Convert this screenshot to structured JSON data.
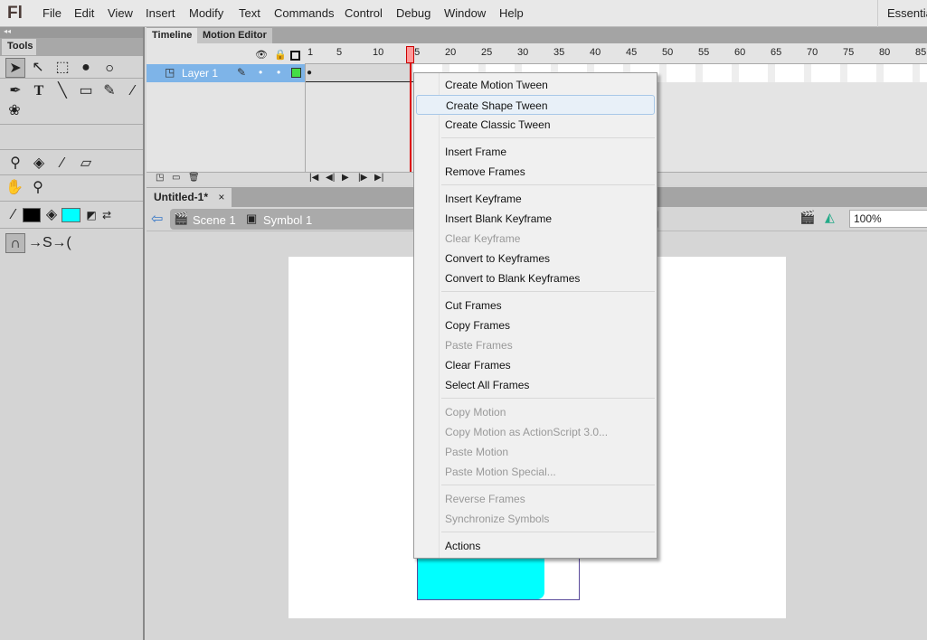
{
  "app": {
    "logo": "Fl",
    "workspace": "Essentials"
  },
  "menubar": [
    "File",
    "Edit",
    "View",
    "Insert",
    "Modify",
    "Text",
    "Commands",
    "Control",
    "Debug",
    "Window",
    "Help"
  ],
  "tools": {
    "collapse": "◂◂",
    "tab": "Tools",
    "stroke_color": "#000000",
    "fill_color": "#00ffff"
  },
  "timeline": {
    "tabs": [
      "Timeline",
      "Motion Editor"
    ],
    "ruler": [
      "1",
      "5",
      "10",
      "15",
      "20",
      "25",
      "30",
      "35",
      "40",
      "45",
      "50",
      "55",
      "60",
      "65",
      "70",
      "75",
      "80",
      "85"
    ],
    "playhead_frame": 15,
    "layer": {
      "name": "Layer 1",
      "color": "#44dd44"
    }
  },
  "document": {
    "tab": "Untitled-1*",
    "close": "×",
    "breadcrumb": [
      "Scene 1",
      "Symbol 1"
    ],
    "zoom": "100%",
    "shape_color": "#00ffff"
  },
  "context_menu": {
    "groups": [
      [
        {
          "label": "Create Motion Tween"
        },
        {
          "label": "Create Shape Tween",
          "highlighted": true
        },
        {
          "label": "Create Classic Tween"
        }
      ],
      [
        {
          "label": "Insert Frame"
        },
        {
          "label": "Remove Frames"
        }
      ],
      [
        {
          "label": "Insert Keyframe"
        },
        {
          "label": "Insert Blank Keyframe"
        },
        {
          "label": "Clear Keyframe",
          "disabled": true
        },
        {
          "label": "Convert to Keyframes"
        },
        {
          "label": "Convert to Blank Keyframes"
        }
      ],
      [
        {
          "label": "Cut Frames"
        },
        {
          "label": "Copy Frames"
        },
        {
          "label": "Paste Frames",
          "disabled": true
        },
        {
          "label": "Clear Frames"
        },
        {
          "label": "Select All Frames"
        }
      ],
      [
        {
          "label": "Copy Motion",
          "disabled": true
        },
        {
          "label": "Copy Motion as ActionScript 3.0...",
          "disabled": true
        },
        {
          "label": "Paste Motion",
          "disabled": true
        },
        {
          "label": "Paste Motion Special...",
          "disabled": true
        }
      ],
      [
        {
          "label": "Reverse Frames",
          "disabled": true
        },
        {
          "label": "Synchronize Symbols",
          "disabled": true
        }
      ],
      [
        {
          "label": "Actions"
        }
      ]
    ]
  }
}
